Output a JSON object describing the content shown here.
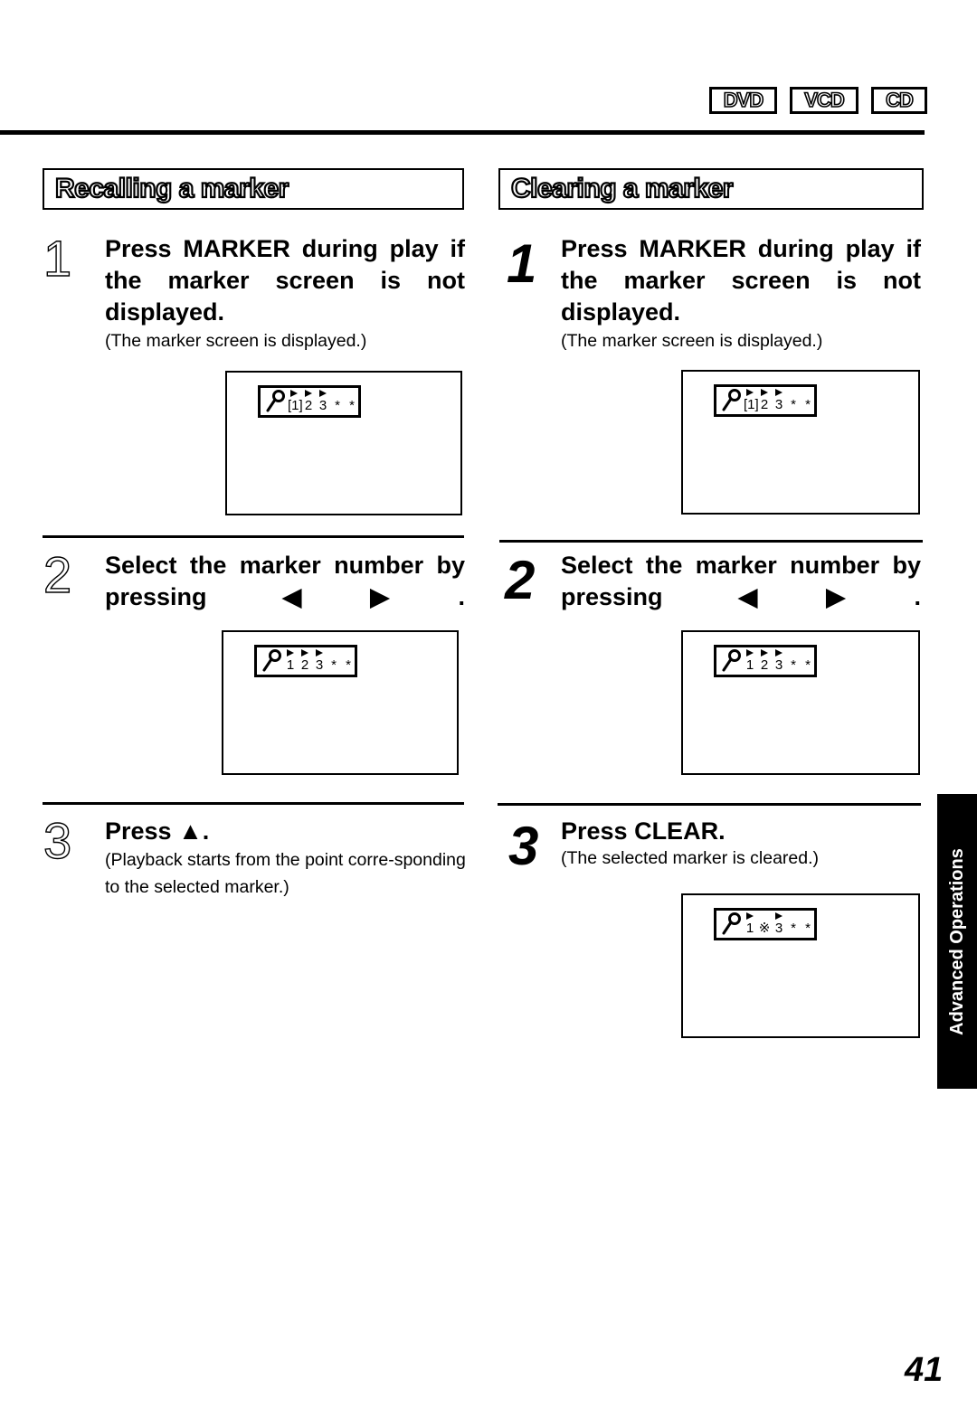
{
  "header": {
    "disc_badges": [
      "DVD",
      "VCD",
      "CD"
    ]
  },
  "recall": {
    "title": "Recalling a marker",
    "steps": [
      {
        "number": "1",
        "instruction": "Press MARKER during play if the marker screen is not displayed.",
        "note": "(The marker screen is displayed.)",
        "screen": {
          "slots": [
            "[1]",
            "2",
            "3",
            "*",
            "*"
          ],
          "arrows": [
            true,
            true,
            true,
            false,
            false
          ]
        }
      },
      {
        "number": "2",
        "instruction": "Select the marker number by pressing ◀▶.",
        "note": "",
        "screen": {
          "slots": [
            "1",
            "2",
            "3",
            "*",
            "*"
          ],
          "arrows": [
            true,
            true,
            true,
            false,
            false
          ]
        }
      },
      {
        "number": "3",
        "instruction": "Press ▲.",
        "note": "(Playback starts from the point corre-sponding to the selected marker.)"
      }
    ]
  },
  "clear": {
    "title": "Clearing a marker",
    "steps": [
      {
        "number": "1",
        "instruction": "Press MARKER during play if the marker screen is not displayed.",
        "note": "(The marker screen is displayed.)",
        "screen": {
          "slots": [
            "[1]",
            "2",
            "3",
            "*",
            "*"
          ],
          "arrows": [
            true,
            true,
            true,
            false,
            false
          ]
        }
      },
      {
        "number": "2",
        "instruction": "Select the marker number by pressing ◀▶.",
        "note": "",
        "screen": {
          "slots": [
            "1",
            "2",
            "3",
            "*",
            "*"
          ],
          "arrows": [
            true,
            true,
            true,
            false,
            false
          ]
        }
      },
      {
        "number": "3",
        "instruction": "Press CLEAR.",
        "note": "(The selected marker is cleared.)",
        "screen": {
          "slots": [
            "1",
            "※",
            "3",
            "*",
            "*"
          ],
          "arrows": [
            true,
            false,
            true,
            false,
            false
          ]
        }
      }
    ]
  },
  "side_tab": {
    "label": "Advanced Operations"
  },
  "footer": {
    "page_number": "41"
  }
}
